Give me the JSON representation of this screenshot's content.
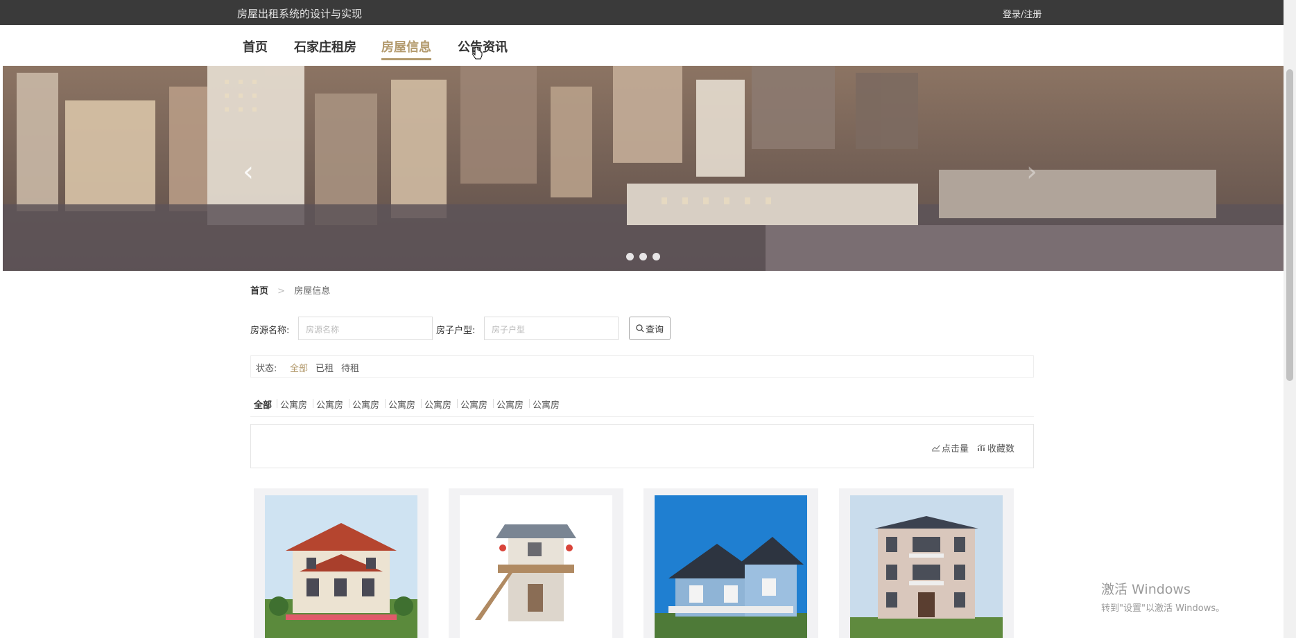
{
  "header": {
    "site_title": "房屋出租系统的设计与实现",
    "login_label": "登录/注册"
  },
  "nav": {
    "items": [
      "首页",
      "石家庄租房",
      "房屋信息",
      "公告资讯"
    ],
    "active_index": 2
  },
  "banner": {
    "slide_count": 3,
    "prev_icon": "chevron-left-icon",
    "next_icon": "chevron-right-icon"
  },
  "breadcrumb": {
    "home": "首页",
    "separator": ">",
    "current": "房屋信息"
  },
  "search": {
    "name_label": "房源名称:",
    "name_placeholder": "房源名称",
    "type_label": "房子户型:",
    "type_placeholder": "房子户型",
    "button_label": "查询"
  },
  "status": {
    "label": "状态:",
    "options": [
      "全部",
      "已租",
      "待租"
    ],
    "active_index": 0
  },
  "types": {
    "items": [
      "全部",
      "公寓房",
      "公寓房",
      "公寓房",
      "公寓房",
      "公寓房",
      "公寓房",
      "公寓房",
      "公寓房"
    ],
    "active_index": 0
  },
  "sort": {
    "clicks_label": "点击量",
    "favorites_label": "收藏数"
  },
  "watermark": {
    "line1": "激活 Windows",
    "line2": "转到\"设置\"以激活 Windows。"
  },
  "colors": {
    "accent": "#b39a6d",
    "topbar": "#3a3a3a"
  }
}
